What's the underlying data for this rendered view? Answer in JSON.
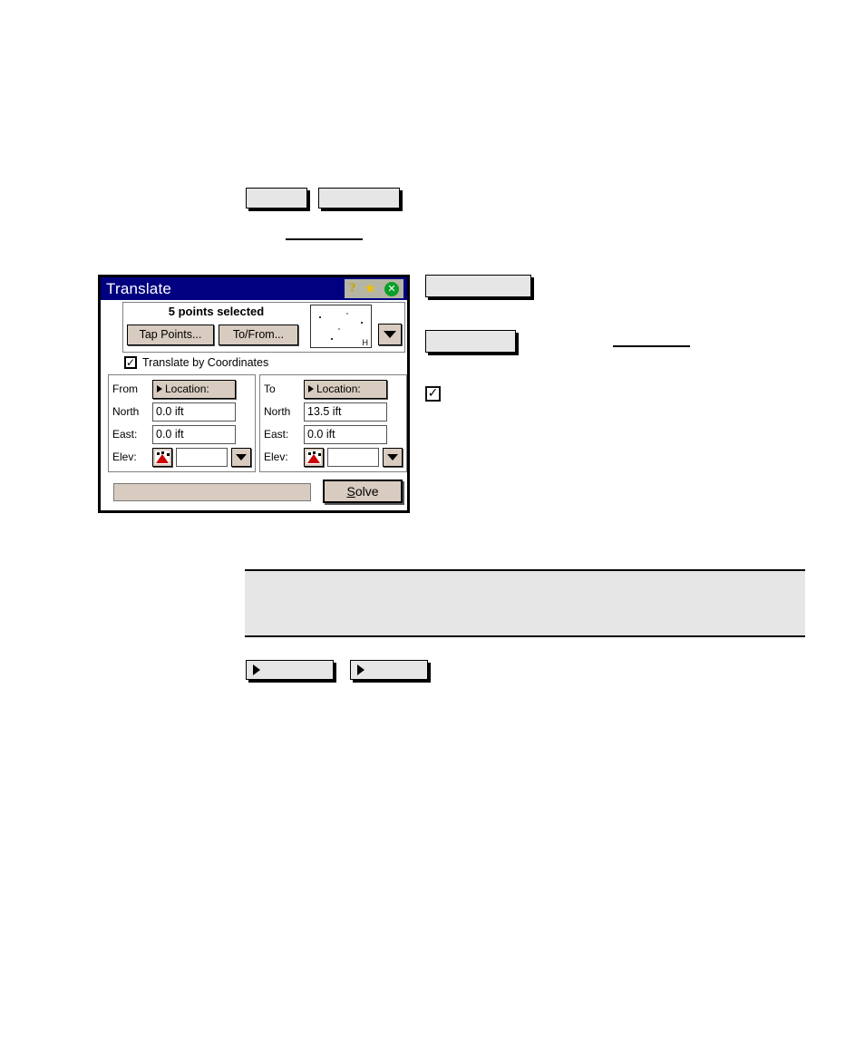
{
  "document": {
    "placeholders": {
      "top_button_1": "",
      "top_button_2": "",
      "right_button_1": "",
      "right_button_2": "",
      "bottom_button_1": "",
      "bottom_button_2": "",
      "gray_block": ""
    }
  },
  "dialog": {
    "title": "Translate",
    "titlebar_icons": {
      "help": "?",
      "favorite": "★",
      "close": "✕"
    },
    "points": {
      "summary": "5 points selected",
      "tap_points_button": "Tap Points...",
      "to_from_button": "To/From...",
      "thumbnail_label": "H",
      "thumbnail_points": [
        {
          "x": 9,
          "y": 12
        },
        {
          "x": 39,
          "y": 8
        },
        {
          "x": 55,
          "y": 18
        },
        {
          "x": 30,
          "y": 25
        },
        {
          "x": 22,
          "y": 36
        }
      ],
      "dropdown_icon": "chevron-down-icon"
    },
    "translate_by_coordinates": {
      "label": "Translate by Coordinates",
      "checked": "✓"
    },
    "from": {
      "group_label": "From",
      "location_button": "Location:",
      "north_label": "North",
      "north_value": "0.0 ift",
      "east_label": "East:",
      "east_value": "0.0 ift",
      "elev_label": "Elev:",
      "elev_value": ""
    },
    "to": {
      "group_label": "To",
      "location_button": "Location:",
      "north_label": "North",
      "north_value": "13.5 ift",
      "east_label": "East:",
      "east_value": "0.0 ift",
      "elev_label": "Elev:",
      "elev_value": ""
    },
    "status_text": "",
    "solve_button": {
      "accel": "S",
      "rest": "olve"
    }
  },
  "colors": {
    "titlebar": "#000080",
    "button_face": "#d8cbc0",
    "close_green": "#0a9f28",
    "star_yellow": "#f0c000",
    "placeholder_gray": "#e6e6e6"
  }
}
